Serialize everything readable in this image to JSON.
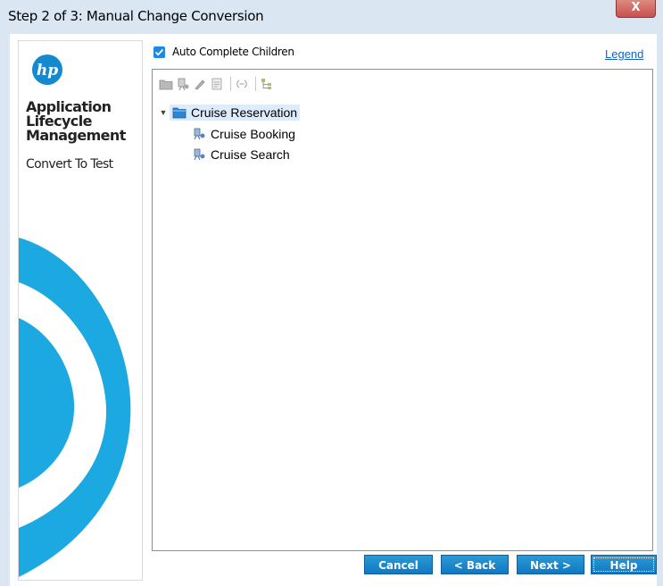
{
  "window": {
    "title": "Step 2 of 3: Manual Change Conversion",
    "close_glyph": "X"
  },
  "sidebar": {
    "logo_text": "hp",
    "brand_lines": [
      "Application",
      "Lifecycle",
      "Management"
    ],
    "subtitle": "Convert To Test",
    "accent_color": "#1ca8e0"
  },
  "options": {
    "auto_complete_children": {
      "label": "Auto Complete Children",
      "checked": true
    },
    "legend_link": "Legend"
  },
  "toolbar": {
    "icons": [
      "folder-icon",
      "test-icon",
      "pen-icon",
      "document-icon",
      "link-icon",
      "tree-view-icon"
    ]
  },
  "tree": {
    "root": {
      "label": "Cruise Reservation",
      "icon": "folder-icon",
      "expanded": true,
      "selected": true
    },
    "children": [
      {
        "label": "Cruise Booking",
        "icon": "test-icon"
      },
      {
        "label": "Cruise Search",
        "icon": "test-icon"
      }
    ]
  },
  "buttons": {
    "cancel": "Cancel",
    "back": "< Back",
    "next": "Next >",
    "help": "Help"
  }
}
